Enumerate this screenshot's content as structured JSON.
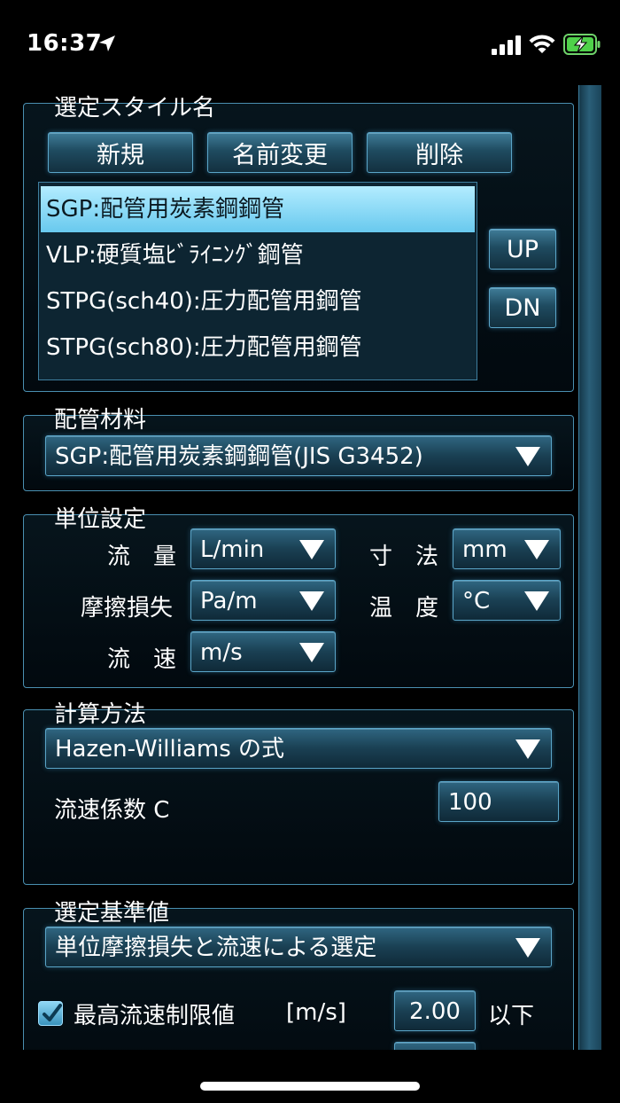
{
  "status": {
    "time": "16:37"
  },
  "style_group": {
    "title": "選定スタイル名",
    "new_label": "新規",
    "rename_label": "名前変更",
    "delete_label": "削除",
    "items": [
      "SGP:配管用炭素鋼鋼管",
      "VLP:硬質塩ﾋﾞﾗｲﾆﾝｸﾞ鋼管",
      "STPG(sch40):圧力配管用鋼管",
      "STPG(sch80):圧力配管用鋼管"
    ],
    "selected_index": 0,
    "up_label": "UP",
    "dn_label": "DN"
  },
  "material_group": {
    "title": "配管材料",
    "value": "SGP:配管用炭素鋼鋼管(JIS G3452)"
  },
  "unit_group": {
    "title": "単位設定",
    "flow_label": "流　量",
    "flow_value": "L/min",
    "size_label": "寸　法",
    "size_value": "mm",
    "friction_label": "摩擦損失",
    "friction_value": "Pa/m",
    "temp_label": "温　度",
    "temp_value": "°C",
    "velocity_label": "流　速",
    "velocity_value": "m/s"
  },
  "calc_group": {
    "title": "計算方法",
    "method_value": "Hazen-Williams の式",
    "coef_label": "流速係数 C",
    "coef_value": "100"
  },
  "criteria_group": {
    "title": "選定基準値",
    "method_value": "単位摩擦損失と流速による選定",
    "max_velocity_label": "最高流速制限値",
    "max_velocity_unit": "[m/s]",
    "max_velocity_value": "2.00",
    "max_velocity_suffix": "以下",
    "max_velocity_checked": true
  }
}
